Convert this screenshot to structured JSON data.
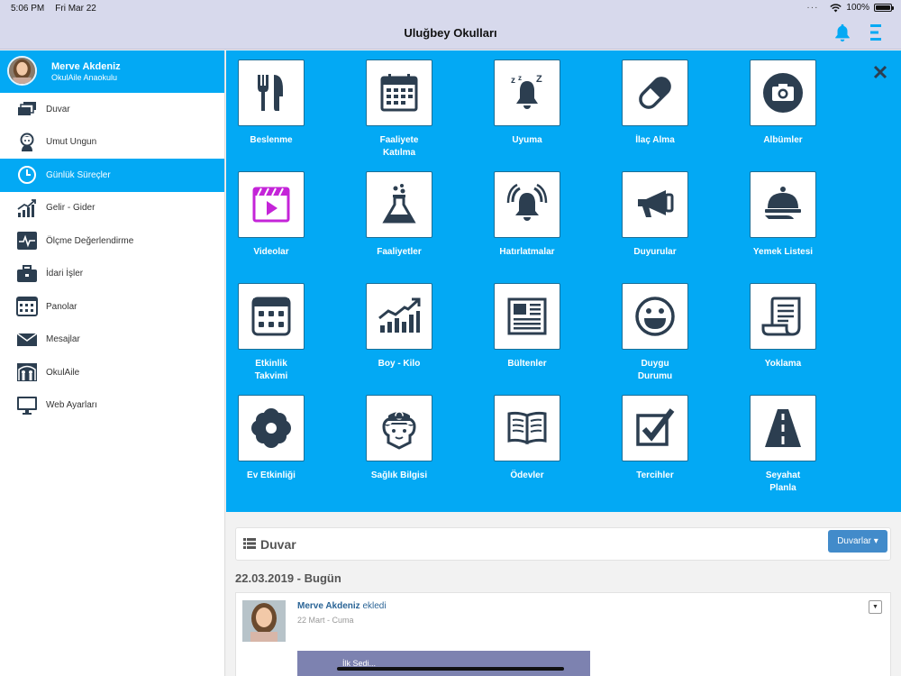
{
  "status": {
    "time": "5:06 PM",
    "date": "Fri Mar 22",
    "battery": "100%"
  },
  "header": {
    "title": "Uluğbey Okulları",
    "bell_icon": "bell-icon",
    "menu_icon": "menu-icon"
  },
  "profile": {
    "name": "Merve Akdeniz",
    "school": "OkulAile Anaokulu"
  },
  "sidebar": {
    "items": [
      {
        "label": "Duvar",
        "icon": "wall-icon"
      },
      {
        "label": "Umut Ungun",
        "icon": "child-icon"
      },
      {
        "label": "Günlük Süreçler",
        "icon": "clock-icon",
        "active": true
      },
      {
        "label": "Gelir - Gider",
        "icon": "chart-icon"
      },
      {
        "label": "Ölçme Değerlendirme",
        "icon": "pulse-icon"
      },
      {
        "label": "İdari İşler",
        "icon": "briefcase-icon"
      },
      {
        "label": "Panolar",
        "icon": "board-icon"
      },
      {
        "label": "Mesajlar",
        "icon": "envelope-icon"
      },
      {
        "label": "OkulAile",
        "icon": "family-icon"
      },
      {
        "label": "Web Ayarları",
        "icon": "monitor-icon"
      }
    ]
  },
  "grid": {
    "close_icon": "close-icon",
    "tiles": [
      {
        "label": "Beslenme",
        "icon": "fork-knife-icon"
      },
      {
        "label": "Faaliyete\nKatılma",
        "icon": "calendar-icon"
      },
      {
        "label": "Uyuma",
        "icon": "sleep-bell-icon"
      },
      {
        "label": "İlaç Alma",
        "icon": "pill-icon"
      },
      {
        "label": "Albümler",
        "icon": "camera-icon"
      },
      {
        "label": "Videolar",
        "icon": "video-icon"
      },
      {
        "label": "Faaliyetler",
        "icon": "flask-icon"
      },
      {
        "label": "Hatırlatmalar",
        "icon": "ringing-bell-icon"
      },
      {
        "label": "Duyurular",
        "icon": "megaphone-icon"
      },
      {
        "label": "Yemek Listesi",
        "icon": "cloche-icon"
      },
      {
        "label": "Etkinlik\nTakvimi",
        "icon": "event-calendar-icon"
      },
      {
        "label": "Boy - Kilo",
        "icon": "growth-chart-icon"
      },
      {
        "label": "Bültenler",
        "icon": "newspaper-icon"
      },
      {
        "label": "Duygu\nDurumu",
        "icon": "smile-icon"
      },
      {
        "label": "Yoklama",
        "icon": "scroll-icon"
      },
      {
        "label": "Ev Etkinliği",
        "icon": "flower-icon"
      },
      {
        "label": "Sağlık Bilgisi",
        "icon": "nurse-icon"
      },
      {
        "label": "Ödevler",
        "icon": "book-icon"
      },
      {
        "label": "Tercihler",
        "icon": "checkbox-icon"
      },
      {
        "label": "Seyahat\nPlanla",
        "icon": "road-icon"
      }
    ]
  },
  "feed": {
    "title": "Duvar",
    "button": "Duvarlar ▾",
    "date_heading": "22.03.2019 - Bugün",
    "post": {
      "author": "Merve Akdeniz",
      "action": "ekledi",
      "time": "22 Mart - Cuma",
      "caret": "▼",
      "media_text": "İlk Sedi..."
    }
  },
  "colors": {
    "accent": "#03a9f4",
    "tile_icon": "#2c3e50",
    "video_icon": "#c424d8",
    "button": "#428bca"
  }
}
